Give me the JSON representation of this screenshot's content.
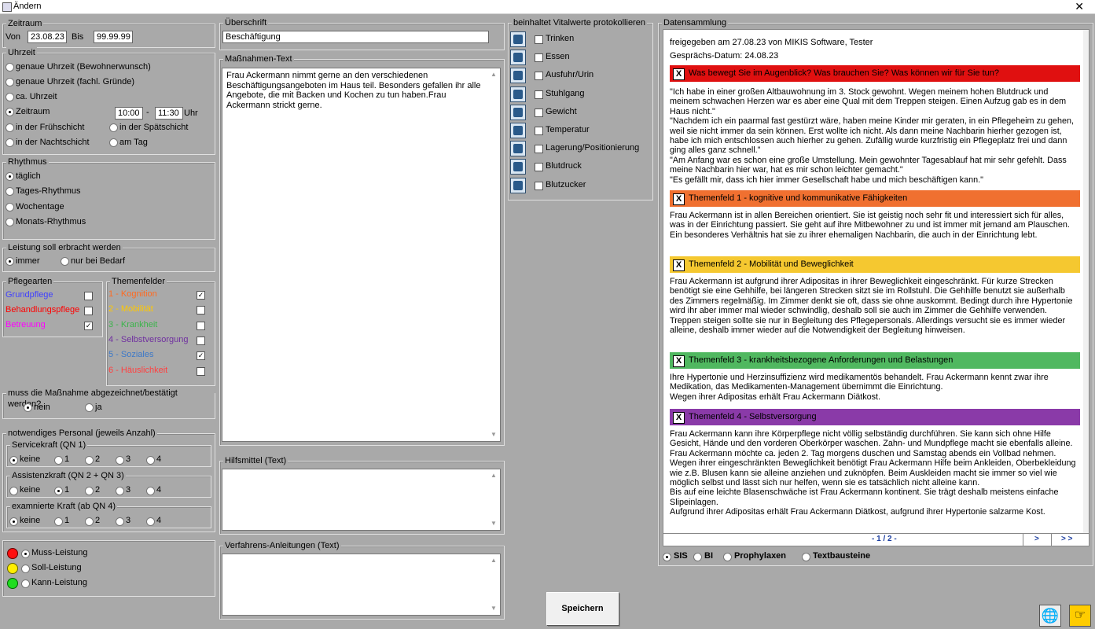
{
  "window": {
    "title": "Ändern",
    "close": "✕"
  },
  "zeitraum": {
    "label": "Zeitraum",
    "von_label": "Von",
    "von": "23.08.23",
    "bis_label": "Bis",
    "bis": "99.99.99"
  },
  "uhrzeit": {
    "label": "Uhrzeit",
    "opt1": "genaue Uhrzeit (Bewohnerwunsch)",
    "opt2": "genaue Uhrzeit (fachl. Gründe)",
    "opt3": "ca. Uhrzeit",
    "opt4": "Zeitraum",
    "from": "10:00",
    "dash": "-",
    "to": "11:30",
    "unit": "Uhr",
    "opt5": "in der Frühschicht",
    "opt6": "in der Spätschicht",
    "opt7": "in der Nachtschicht",
    "opt8": "am Tag"
  },
  "rhythmus": {
    "label": "Rhythmus",
    "opt1": "täglich",
    "opt2": "Tages-Rhythmus",
    "opt3": "Wochentage",
    "opt4": "Monats-Rhythmus"
  },
  "leistung": {
    "label": "Leistung soll erbracht werden",
    "opt1": "immer",
    "opt2": "nur bei Bedarf"
  },
  "pflegearten": {
    "label": "Pflegearten",
    "items": [
      {
        "label": "Grundpflege",
        "color": "#4040ff",
        "checked": ""
      },
      {
        "label": "Behandlungspflege",
        "color": "#ff0000",
        "checked": ""
      },
      {
        "label": "Betreuung",
        "color": "#ff00ff",
        "checked": "✓"
      }
    ]
  },
  "themenfelder": {
    "label": "Themenfelder",
    "items": [
      {
        "label": "1 - Kognition",
        "color": "#ff6a20",
        "checked": "✓"
      },
      {
        "label": "2 - Mobilität",
        "color": "#ffc800",
        "checked": ""
      },
      {
        "label": "3 - Krankheit",
        "color": "#3cb44b",
        "checked": ""
      },
      {
        "label": "4 - Selbstversorgung",
        "color": "#7030a0",
        "checked": ""
      },
      {
        "label": "5 - Soziales",
        "color": "#3c78c8",
        "checked": "✓"
      },
      {
        "label": "6 - Häuslichkeit",
        "color": "#ff4040",
        "checked": ""
      }
    ]
  },
  "abzeichnen": {
    "label": "muss die Maßnahme abgezeichnet/bestätigt werden?",
    "opt1": "nein",
    "opt2": "ja"
  },
  "personal": {
    "label": "notwendiges Personal (jeweils Anzahl)",
    "groups": [
      {
        "label": "Servicekraft (QN 1)",
        "opts": [
          "keine",
          "1",
          "2",
          "3",
          "4"
        ]
      },
      {
        "label": "Assistenzkraft (QN 2 + QN 3)",
        "opts": [
          "keine",
          "1",
          "2",
          "3",
          "4"
        ]
      },
      {
        "label": "examnierte Kraft (ab QN 4)",
        "opts": [
          "keine",
          "1",
          "2",
          "3",
          "4"
        ]
      }
    ]
  },
  "leistungsart": {
    "opt1": "Muss-Leistung",
    "opt2": "Soll-Leistung",
    "opt3": "Kann-Leistung"
  },
  "ueberschrift": {
    "label": "Überschrift",
    "value": "Beschäftigung"
  },
  "massnahmen": {
    "label": "Maßnahmen-Text",
    "text": "Frau Ackermann nimmt gerne an den verschiedenen Beschäftigungsangeboten im Haus teil. Besonders gefallen ihr alle Angebote, die mit Backen und Kochen zu tun haben.Frau Ackermann strickt gerne."
  },
  "hilfsmittel": {
    "label": "Hilfsmittel (Text)"
  },
  "verfahren": {
    "label": "Verfahrens-Anleitungen (Text)"
  },
  "vital": {
    "label": "beinhaltet Vitalwerte protokollieren",
    "items": [
      "Trinken",
      "Essen",
      "Ausfuhr/Urin",
      "Stuhlgang",
      "Gewicht",
      "Temperatur",
      "Lagerung/Positionierung",
      "Blutdruck",
      "Blutzucker"
    ]
  },
  "speichern": "Speichern",
  "datensammlung": {
    "label": "Datensammlung",
    "freigegeben": "freigegeben am 27.08.23 von MIKIS Software, Tester",
    "datum": "Gesprächs-Datum: 24.08.23",
    "sections": [
      {
        "title": "Was bewegt Sie im Augenblick? Was brauchen Sie? Was können wir für Sie tun?",
        "color": "#e01010",
        "text": "\"Ich habe in einer großen Altbauwohnung im 3. Stock gewohnt. Wegen meinem hohen Blutdruck und meinem schwachen Herzen war es aber eine Qual mit dem Treppen steigen. Einen Aufzug gab es in dem Haus nicht.\"\n\"Nachdem ich ein paarmal fast gestürzt wäre, haben meine Kinder mir geraten, in ein Pflegeheim zu gehen, weil sie nicht immer da sein können. Erst wollte ich nicht. Als dann meine Nachbarin hierher gezogen ist, habe ich mich entschlossen auch hierher zu gehen. Zufällig wurde kurzfristig ein Pflegeplatz frei und dann ging alles ganz schnell.\"\n\"Am Anfang war es schon eine große Umstellung. Mein gewohnter Tagesablauf hat mir sehr gefehlt. Dass meine Nachbarin hier war, hat es mir schon leichter gemacht.\"\n\"Es gefällt mir, dass ich hier immer Gesellschaft habe und mich beschäftigen kann.\""
      },
      {
        "title": "Themenfeld 1 - kognitive und kommunikative Fähigkeiten",
        "color": "#f07030",
        "text": "Frau Ackermann ist in allen Bereichen orientiert. Sie ist geistig noch sehr fit und interessiert sich für alles, was in der Einrichtung passiert. Sie geht auf ihre Mitbewohner zu und ist immer mit jemand am Plauschen. Ein besonderes Verhältnis hat sie zu ihrer ehemaligen Nachbarin, die auch in der Einrichtung lebt."
      },
      {
        "title": "Themenfeld 2 - Mobilität und Beweglichkeit",
        "color": "#f5c830",
        "text": "Frau Ackermann ist aufgrund ihrer Adipositas in ihrer Beweglichkeit eingeschränkt. Für kurze Strecken benötigt sie eine Gehhilfe, bei längeren Strecken sitzt sie im Rollstuhl. Die Gehhilfe benutzt sie außerhalb des Zimmers regelmäßig. Im Zimmer denkt sie oft, dass sie ohne auskommt. Bedingt durch ihre Hypertonie wird ihr aber immer mal wieder schwindlig, deshalb soll sie auch im Zimmer die Gehhilfe verwenden.\nTreppen steigen sollte sie nur in Begleitung des Pflegepersonals. Allerdings versucht sie es immer wieder alleine, deshalb immer wieder auf die Notwendigkeit der Begleitung hinweisen."
      },
      {
        "title": "Themenfeld 3 - krankheitsbezogene Anforderungen und Belastungen",
        "color": "#50b860",
        "text": "Ihre Hypertonie und Herzinsuffizienz wird medikamentös behandelt. Frau Ackermann kennt zwar ihre Medikation, das Medikamenten-Management übernimmt die Einrichtung.\nWegen ihrer Adipositas erhält Frau Ackermann Diätkost."
      },
      {
        "title": "Themenfeld 4 - Selbstversorgung",
        "color": "#8a3aa8",
        "text": "Frau Ackermann kann ihre Körperpflege nicht völlig selbständig durchführen. Sie kann sich ohne Hilfe Gesicht, Hände und den vorderen Oberkörper waschen. Zahn- und Mundpflege macht sie ebenfalls alleine. Frau Ackermann möchte ca. jeden 2. Tag morgens duschen und Samstag abends ein Vollbad nehmen.\nWegen ihrer eingeschränkten Beweglichkeit benötigt Frau Ackermann Hilfe beim Ankleiden, Oberbekleidung wie z.B. Blusen kann sie alleine anziehen und zuknöpfen. Beim Auskleiden macht sie immer so viel wie möglich selbst und lässt sich nur helfen, wenn sie es tatsächlich nicht alleine kann.\nBis auf eine leichte Blasenschwäche ist Frau Ackermann kontinent. Sie trägt deshalb meistens einfache Slipeinlagen.\nAufgrund ihrer Adipositas erhält Frau Ackermann Diätkost, aufgrund ihrer Hypertonie salzarme Kost."
      }
    ],
    "page": "- 1 / 2 -",
    "next": ">",
    "last": "> >",
    "tabs": {
      "sis": "SIS",
      "bi": "BI",
      "prophylaxen": "Prophylaxen",
      "textbausteine": "Textbausteine"
    }
  }
}
